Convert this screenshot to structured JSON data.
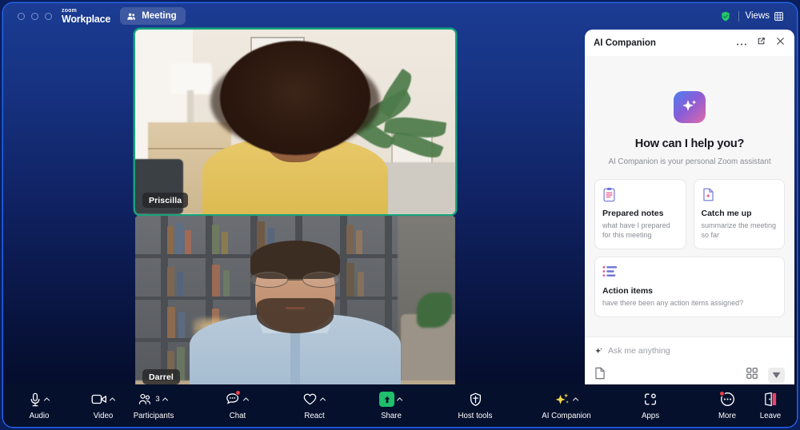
{
  "window": {
    "brand_zoom": "zoom",
    "brand_workplace": "Workplace",
    "meeting_tab_label": "Meeting",
    "views_label": "Views",
    "encryption_icon": "green-shield-icon",
    "grid_icon": "grid-view-icon",
    "accent_blue": "#2563eb",
    "background_top": "#1b3c93",
    "background_bottom": "#050e2e"
  },
  "gallery": {
    "tiles": [
      {
        "name": "Priscilla",
        "active_speaker": true,
        "active_border_color": "#16a37b",
        "description": "woman with afro hair in yellow top, bright home office"
      },
      {
        "name": "Darrel",
        "active_speaker": false,
        "description": "man with glasses and beard in light blue shirt, bookshelf background"
      }
    ]
  },
  "ai_panel": {
    "title": "AI Companion",
    "more_icon": "ellipsis-icon",
    "popout_icon": "open-in-new-window-icon",
    "close_icon": "close-icon",
    "hero_icon": "ai-sparkle-icon",
    "hero_title": "How can I help you?",
    "hero_subtitle": "AI Companion is your personal Zoom assistant",
    "suggestion_cards": [
      {
        "icon": "clipboard-notes-icon",
        "title": "Prepared notes",
        "description": "what have I prepared for this meeting"
      },
      {
        "icon": "document-sparkle-icon",
        "title": "Catch me up",
        "description": "summarize the meeting so far"
      },
      {
        "icon": "action-list-icon",
        "title": "Action items",
        "description": "have there been any action items assigned?"
      }
    ],
    "composer": {
      "sparkle_icon": "sparkle-icon",
      "placeholder": "Ask me anything",
      "value": "",
      "attach_icon": "document-icon",
      "apps_icon": "apps-grid-icon",
      "send_icon": "send-icon"
    }
  },
  "toolbar": {
    "left": [
      {
        "icon": "microphone-icon",
        "label": "Audio",
        "has_chevron": true
      },
      {
        "icon": "video-camera-icon",
        "label": "Video",
        "has_chevron": true
      }
    ],
    "center": [
      {
        "icon": "participants-icon",
        "label": "Participants",
        "has_chevron": true,
        "count": "3"
      },
      {
        "icon": "chat-bubble-icon",
        "label": "Chat",
        "has_chevron": true,
        "notification": true
      },
      {
        "icon": "heart-icon",
        "label": "React",
        "has_chevron": true
      },
      {
        "icon": "share-screen-icon",
        "label": "Share",
        "has_chevron": true,
        "highlight_color": "#1fbf6b"
      },
      {
        "icon": "shield-icon",
        "label": "Host tools",
        "has_chevron": false
      },
      {
        "icon": "ai-companion-sparkle-icon",
        "label": "AI Companion",
        "has_chevron": true,
        "icon_color": "#f5d547"
      },
      {
        "icon": "apps-icon",
        "label": "Apps",
        "has_chevron": false
      },
      {
        "icon": "more-dots-icon",
        "label": "More",
        "has_chevron": false,
        "notification": true
      }
    ],
    "right": {
      "icon": "leave-door-icon",
      "label": "Leave",
      "icon_color": "#e8466a"
    }
  }
}
